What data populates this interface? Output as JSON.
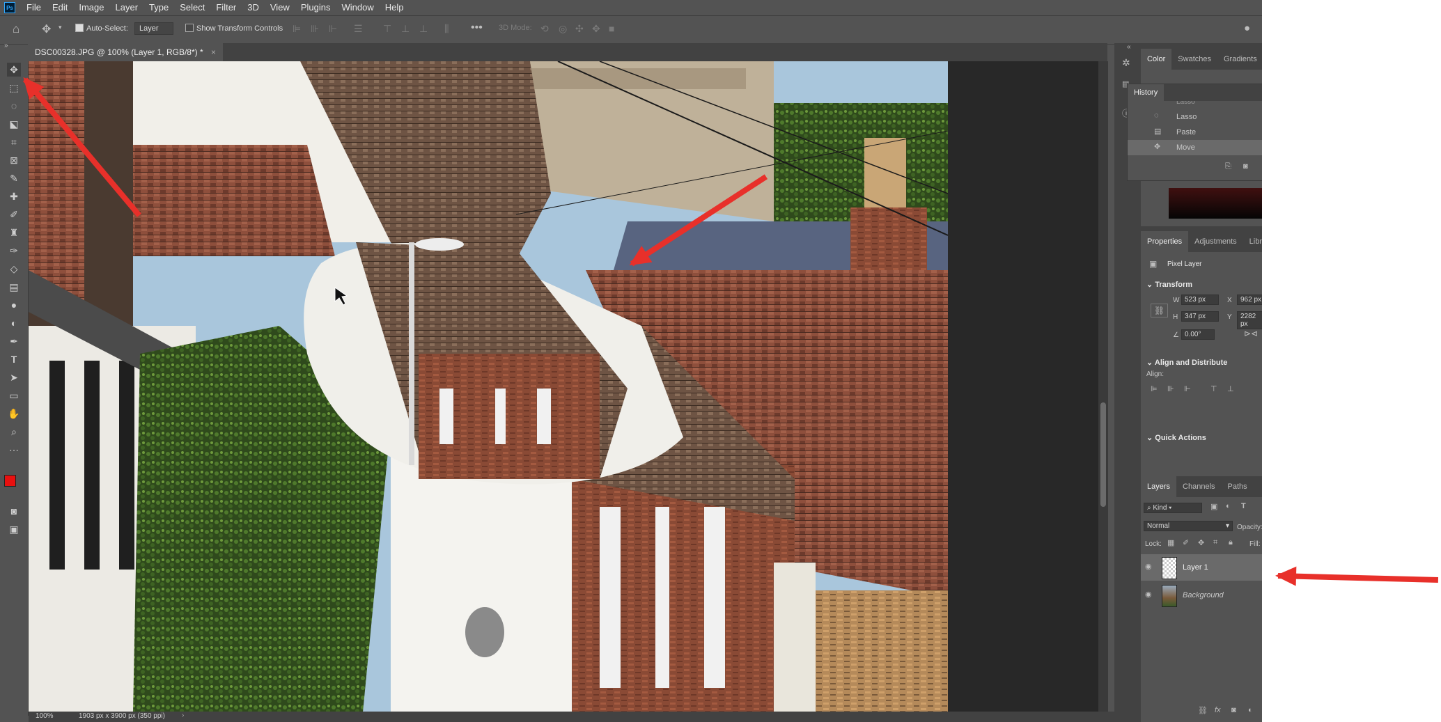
{
  "menu": {
    "items": [
      "File",
      "Edit",
      "Image",
      "Layer",
      "Type",
      "Select",
      "Filter",
      "3D",
      "View",
      "Plugins",
      "Window",
      "Help"
    ]
  },
  "options_bar": {
    "auto_select_label": "Auto-Select:",
    "auto_select_value": "Layer",
    "show_transform_label": "Show Transform Controls",
    "mode_3d": "3D Mode:"
  },
  "document": {
    "tab_title": "DSC00328.JPG @ 100% (Layer 1, RGB/8*) *",
    "zoom": "100%",
    "doc_info": "1903 px x 3900 px (350 ppi)"
  },
  "color_panel": {
    "tabs": [
      "Color",
      "Swatches",
      "Gradients"
    ]
  },
  "history": {
    "title": "History",
    "items": [
      "Lasso",
      "Paste",
      "Move"
    ],
    "cut_item": "Lasso"
  },
  "properties": {
    "tabs": [
      "Properties",
      "Adjustments",
      "Librar"
    ],
    "layer_kind": "Pixel Layer",
    "transform_title": "Transform",
    "w_label": "W",
    "w_value": "523 px",
    "h_label": "H",
    "h_value": "347 px",
    "x_label": "X",
    "x_value": "962 px",
    "y_label": "Y",
    "y_value": "2282 px",
    "angle": "0.00°",
    "align_title": "Align and Distribute",
    "align_label": "Align:",
    "quick_actions": "Quick Actions"
  },
  "layers": {
    "tabs": [
      "Layers",
      "Channels",
      "Paths"
    ],
    "filter_kind": "Kind",
    "blend_mode": "Normal",
    "opacity_label": "Opacity:",
    "lock_label": "Lock:",
    "fill_label": "Fill:",
    "items": [
      {
        "name": "Layer 1",
        "selected": true
      },
      {
        "name": "Background",
        "selected": false
      }
    ]
  },
  "colors": {
    "foreground": "#e8100f",
    "background": "#ffffff",
    "annotation_arrow": "#e8302a"
  }
}
